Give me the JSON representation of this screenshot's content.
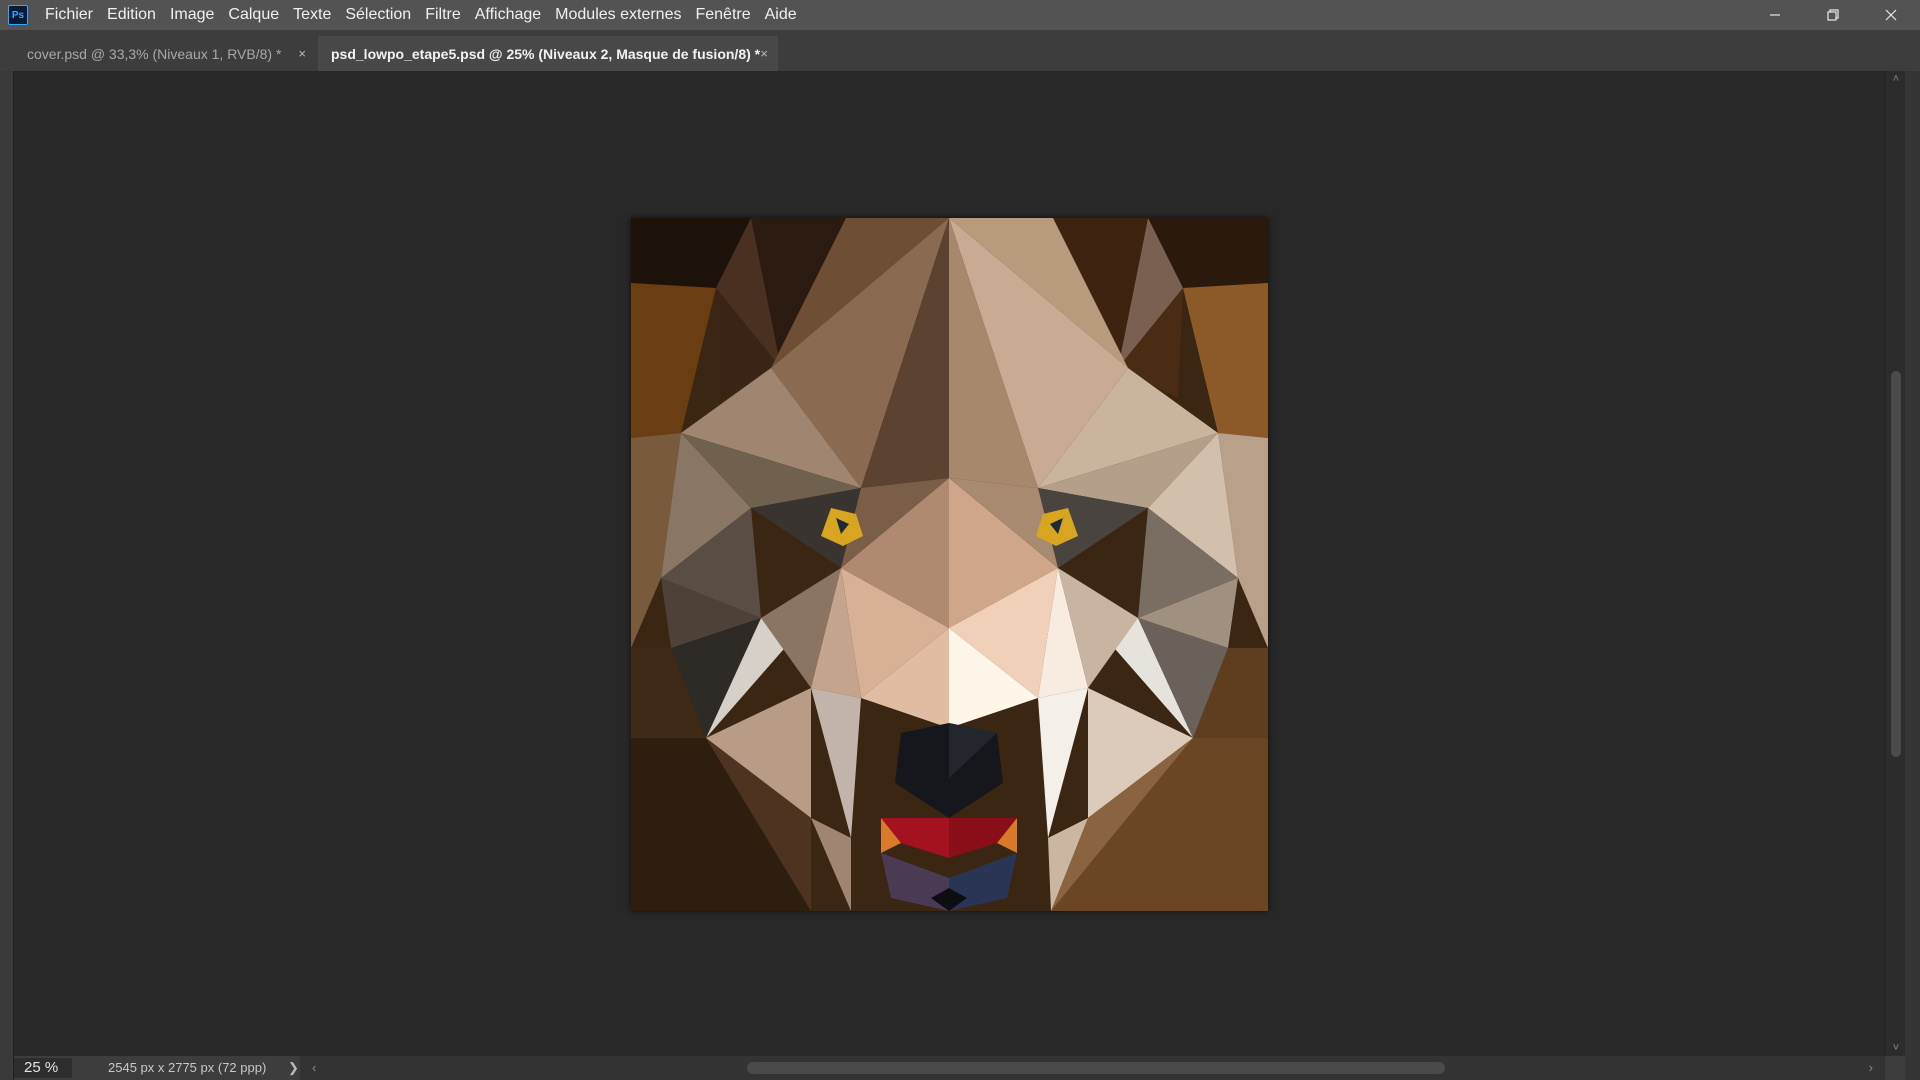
{
  "app": {
    "logo_text": "Ps"
  },
  "menu": [
    "Fichier",
    "Edition",
    "Image",
    "Calque",
    "Texte",
    "Sélection",
    "Filtre",
    "Affichage",
    "Modules externes",
    "Fenêtre",
    "Aide"
  ],
  "window_controls": {
    "minimize": "—",
    "restore": "❐",
    "close": "✕"
  },
  "tabs": [
    {
      "label": "cover.psd @ 33,3% (Niveaux 1, RVB/8) *",
      "close": "×",
      "active": false
    },
    {
      "label": "psd_lowpo_etape5.psd @ 25% (Niveaux 2, Masque de fusion/8) *",
      "close": "×",
      "active": true
    }
  ],
  "status": {
    "zoom": "25 %",
    "doc_info": "2545 px x 2775 px (72 ppp)",
    "arrow": "❯"
  },
  "scroll": {
    "vertical_position": 0.23,
    "horizontal_position": 0.28,
    "arrows": {
      "up": "˄",
      "down": "˅",
      "left": "‹",
      "right": "›"
    }
  },
  "document_image": {
    "icon": "low-poly-wolf-illustration",
    "colors": {
      "nose": "#15171c",
      "eye": "#d8a520",
      "mouth": "#a3121e",
      "fur_light": "#e3c6ad",
      "fur_dark": "#3b2510"
    }
  }
}
